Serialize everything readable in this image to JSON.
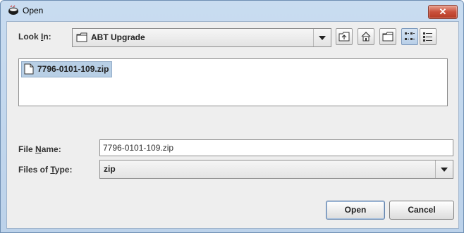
{
  "window": {
    "title": "Open",
    "title_icon": "java-coffee-cup-icon",
    "close_icon": "close-icon",
    "close_glyph": "✕"
  },
  "look_in": {
    "label_prefix": "Look ",
    "label_mnemonic": "I",
    "label_suffix": "n:",
    "value": "ABT Upgrade",
    "value_icon": "folder-icon"
  },
  "toolbar": {
    "buttons": [
      {
        "name": "up-one-level",
        "icon": "folder-up-icon"
      },
      {
        "name": "home",
        "icon": "home-icon"
      },
      {
        "name": "create-new-folder",
        "icon": "new-folder-icon"
      },
      {
        "name": "list-view",
        "icon": "list-view-icon",
        "selected": true
      },
      {
        "name": "details-view",
        "icon": "details-view-icon",
        "selected": false
      }
    ]
  },
  "file_list": {
    "items": [
      {
        "name": "7796-0101-109.zip",
        "icon": "file-icon",
        "selected": true
      }
    ]
  },
  "file_name": {
    "label_prefix": "File ",
    "label_mnemonic": "N",
    "label_suffix": "ame:",
    "value": "7796-0101-109.zip"
  },
  "file_type": {
    "label_prefix": "Files of ",
    "label_mnemonic": "T",
    "label_suffix": "ype:",
    "value": "zip"
  },
  "buttons": {
    "open_label": "Open",
    "cancel_label": "Cancel"
  },
  "colors": {
    "title_bar": "#c9dcf0",
    "close_button": "#c9503b",
    "selection": "#b8cfe5",
    "panel": "#eeeeee"
  }
}
